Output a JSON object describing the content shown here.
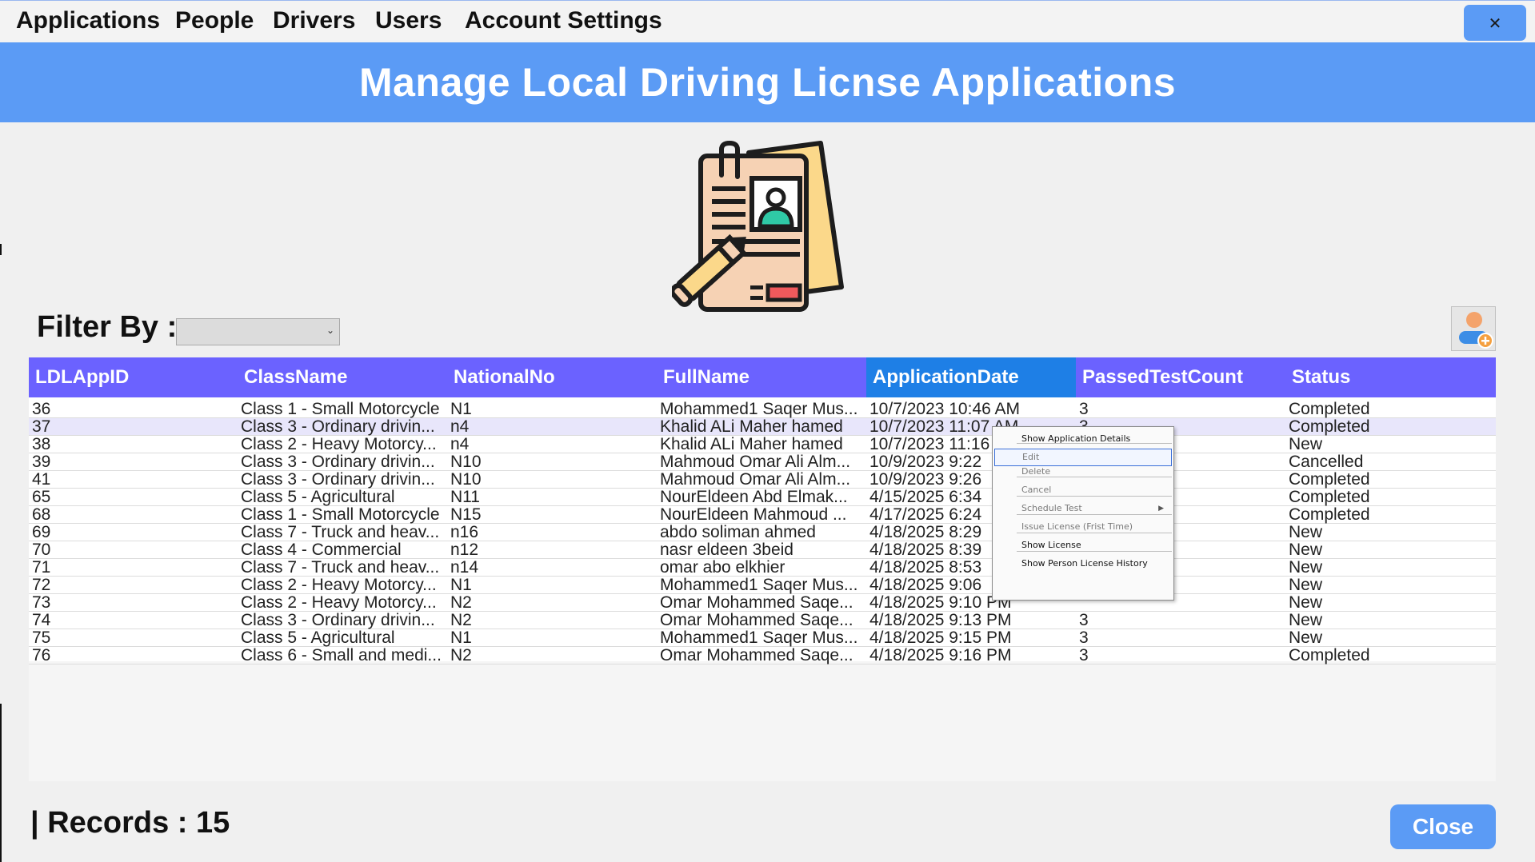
{
  "menu": {
    "items": [
      "Applications",
      "People",
      "Drivers",
      "Users",
      "Account Settings"
    ],
    "close_glyph": "✕"
  },
  "header": {
    "title": "Manage Local Driving Licnse Applications"
  },
  "illustration": {
    "icon": "license-application-clipboard-icon"
  },
  "filter": {
    "label": "Filter By :",
    "selected": ""
  },
  "add_button": {
    "icon": "add-person-icon"
  },
  "table": {
    "columns": [
      "LDLAppID",
      "ClassName",
      "NationalNo",
      "FullName",
      "ApplicationDate",
      "PassedTestCount",
      "Status"
    ],
    "sorted_column": "ApplicationDate",
    "selected_row_index": 1,
    "rows": [
      [
        "36",
        "Class 1 - Small Motorcycle",
        "N1",
        "Mohammed1 Saqer Mus...",
        "10/7/2023 10:46 AM",
        "3",
        "Completed"
      ],
      [
        "37",
        "Class 3 - Ordinary drivin...",
        "n4",
        "Khalid ALi Maher hamed",
        "10/7/2023 11:07 AM",
        "3",
        "Completed"
      ],
      [
        "38",
        "Class 2 - Heavy Motorcy...",
        "n4",
        "Khalid ALi Maher hamed",
        "10/7/2023 11:16",
        "",
        "New"
      ],
      [
        "39",
        "Class 3 - Ordinary drivin...",
        "N10",
        "Mahmoud Omar Ali Alm...",
        "10/9/2023 9:22",
        "",
        "Cancelled"
      ],
      [
        "41",
        "Class 3 - Ordinary drivin...",
        "N10",
        "Mahmoud Omar Ali Alm...",
        "10/9/2023 9:26",
        "",
        "Completed"
      ],
      [
        "65",
        "Class 5 - Agricultural",
        "N11",
        "NourEldeen Abd  Elmak...",
        "4/15/2025 6:34",
        "",
        "Completed"
      ],
      [
        "68",
        "Class 1 - Small Motorcycle",
        "N15",
        "NourEldeen Mahmoud ...",
        "4/17/2025 6:24",
        "",
        "Completed"
      ],
      [
        "69",
        "Class 7 - Truck and heav...",
        "n16",
        "abdo soliman  ahmed",
        "4/18/2025 8:29",
        "",
        "New"
      ],
      [
        "70",
        "Class 4 - Commercial",
        "n12",
        "nasr  eldeen  3beid",
        "4/18/2025 8:39",
        "",
        "New"
      ],
      [
        "71",
        "Class 7 - Truck and heav...",
        "n14",
        "omar  abo  elkhier",
        "4/18/2025 8:53",
        "",
        "New"
      ],
      [
        "72",
        "Class 2 - Heavy Motorcy...",
        "N1",
        "Mohammed1 Saqer Mus...",
        "4/18/2025 9:06",
        "",
        "New"
      ],
      [
        "73",
        "Class 2 - Heavy Motorcy...",
        "N2",
        "Omar Mohammed Saqe...",
        "4/18/2025 9:10 PM",
        "",
        "New"
      ],
      [
        "74",
        "Class 3 - Ordinary drivin...",
        "N2",
        "Omar Mohammed Saqe...",
        "4/18/2025 9:13 PM",
        "3",
        "New"
      ],
      [
        "75",
        "Class 5 - Agricultural",
        "N1",
        "Mohammed1 Saqer Mus...",
        "4/18/2025 9:15 PM",
        "3",
        "New"
      ],
      [
        "76",
        "Class 6 - Small and medi...",
        "N2",
        "Omar Mohammed Saqe...",
        "4/18/2025 9:16 PM",
        "3",
        "Completed"
      ]
    ]
  },
  "context_menu": {
    "items": [
      {
        "label": "Show Application Details",
        "enabled": true,
        "highlighted": false,
        "submenu": false
      },
      {
        "label": "Edit",
        "enabled": false,
        "highlighted": true,
        "submenu": false
      },
      {
        "label": "Delete",
        "enabled": false,
        "highlighted": false,
        "submenu": false
      },
      {
        "label": "Cancel",
        "enabled": false,
        "highlighted": false,
        "submenu": false
      },
      {
        "label": "Schedule Test",
        "enabled": false,
        "highlighted": false,
        "submenu": true
      },
      {
        "label": "Issue License (Frist Time)",
        "enabled": false,
        "highlighted": false,
        "submenu": false
      },
      {
        "label": "Show License",
        "enabled": true,
        "highlighted": false,
        "submenu": false
      },
      {
        "label": "Show Person License History",
        "enabled": true,
        "highlighted": false,
        "submenu": false
      }
    ]
  },
  "footer": {
    "records_label": "| Records :",
    "records_count": "15",
    "close_label": "Close"
  },
  "colors": {
    "accent_blue": "#5b9bf5",
    "grid_header": "#6b62ff",
    "sorted_header": "#1e7fe6",
    "selected_row": "#e8e6fb"
  }
}
